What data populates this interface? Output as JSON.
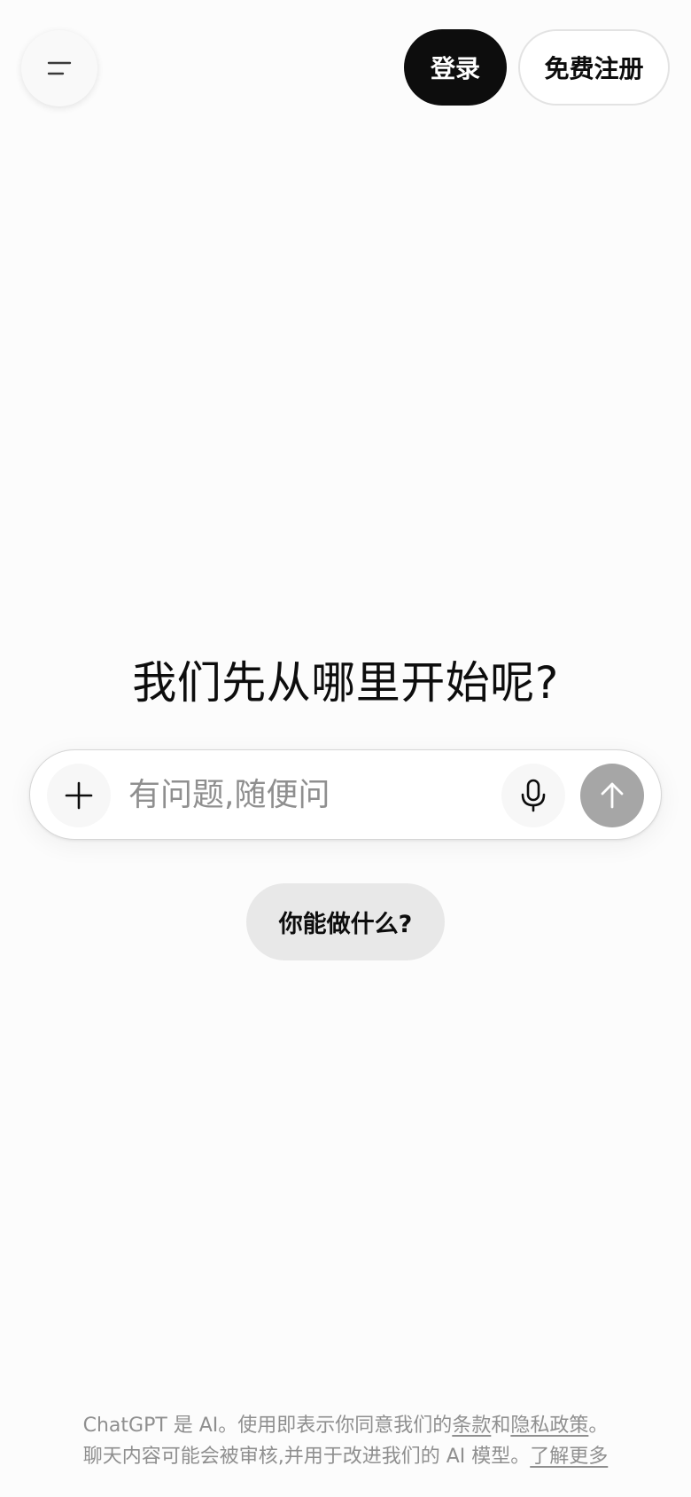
{
  "header": {
    "menu_icon": "menu-icon",
    "login_label": "登录",
    "signup_label": "免费注册"
  },
  "main": {
    "heading": "我们先从哪里开始呢?",
    "composer": {
      "placeholder": "有问题,随便问",
      "attach_icon": "plus-icon",
      "mic_icon": "microphone-icon",
      "send_icon": "arrow-up-icon"
    },
    "suggestion_label": "你能做什么?"
  },
  "footer": {
    "line1_prefix": "ChatGPT 是 AI。使用即表示你同意我们的",
    "terms_link": "条款",
    "line1_and": "和",
    "privacy_link": "隐私政策",
    "line1_suffix": "。",
    "line2_text": "聊天内容可能会被审核,并用于改进我们的 AI 模型。",
    "learn_more_link": "了解更多"
  },
  "colors": {
    "background": "#fcfcfc",
    "primary_button": "#0d0d0d",
    "send_button_disabled": "#a6a6a6",
    "suggestion_chip": "#e8e8e8",
    "muted_text": "#8f8f8f"
  }
}
